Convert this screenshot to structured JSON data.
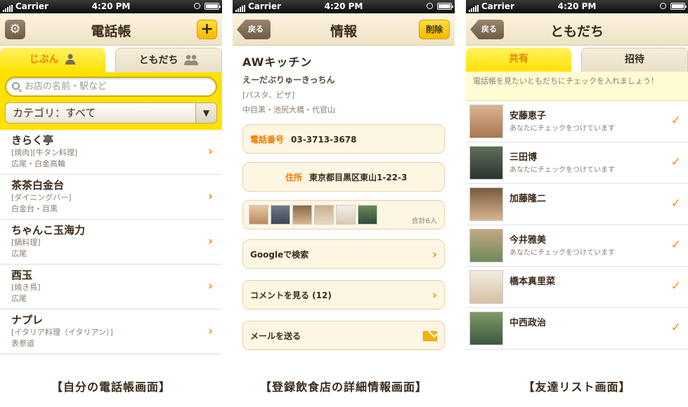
{
  "status": {
    "carrier": "Carrier",
    "time": "4:20 PM"
  },
  "screen1": {
    "title": "電話帳",
    "tabs": [
      "じぶん",
      "ともだち"
    ],
    "search_placeholder": "お店の名前・駅など",
    "category": "カテゴリ：すべて",
    "rows": [
      {
        "name": "きらく亭",
        "genre": "[焼肉][牛タン料理]",
        "area": "広尾・白金高輪"
      },
      {
        "name": "茶茶白金台",
        "genre": "[ダイニングバー]",
        "area": "白金台・目黒"
      },
      {
        "name": "ちゃんこ玉海力",
        "genre": "[鍋料理]",
        "area": "広尾"
      },
      {
        "name": "酉玉",
        "genre": "[焼き鳥]",
        "area": "広尾"
      },
      {
        "name": "ナプレ",
        "genre": "[イタリア料理（イタリアン）]",
        "area": "表参道"
      }
    ],
    "caption": "【自分の電話帳画面】"
  },
  "screen2": {
    "back": "戻る",
    "title": "情報",
    "delete": "削除",
    "shop_name": "AWキッチン",
    "shop_kana": "えーだぶりゅーきっちん",
    "genre": "[パスタ、ピザ]",
    "area": "中目黒・池尻大橋・代官山",
    "phone_label": "電話番号",
    "phone": "03-3713-3678",
    "address_label": "住所",
    "address": "東京都目黒区東山1-22-3",
    "total": "合計6人",
    "google": "Googleで検索",
    "comments": "コメントを見る (12)",
    "mail": "メールを送る",
    "caption": "【登録飲食店の詳細情報画面】"
  },
  "screen3": {
    "back": "戻る",
    "title": "ともだち",
    "tabs": [
      "共有",
      "招待"
    ],
    "notice": "電話帳を見たいともだちにチェックを入れましょう！",
    "friends": [
      {
        "name": "安藤恵子",
        "status": "あなたにチェックをつけています"
      },
      {
        "name": "三田博",
        "status": "あなたにチェックをつけています"
      },
      {
        "name": "加藤隆二",
        "status": ""
      },
      {
        "name": "今井雅美",
        "status": "あなたにチェックをつけています"
      },
      {
        "name": "橋本真里菜",
        "status": ""
      },
      {
        "name": "中西政治",
        "status": ""
      }
    ],
    "caption": "【友達リスト画面】"
  }
}
